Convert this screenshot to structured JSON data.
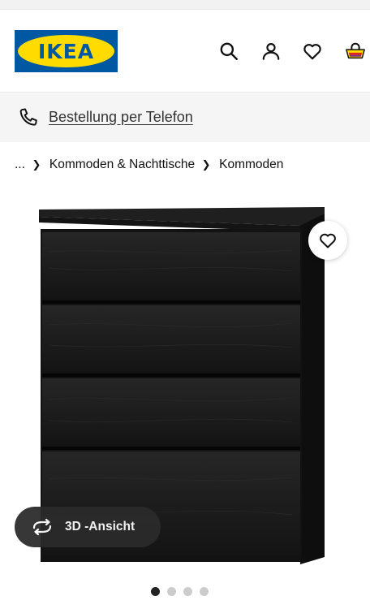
{
  "header": {
    "logo_text": "IKEA",
    "icons": [
      "search-icon",
      "user-icon",
      "heart-icon",
      "shopping-bag-icon"
    ]
  },
  "phone_bar": {
    "label": "Bestellung per Telefon",
    "icon": "phone-icon"
  },
  "breadcrumb": {
    "items": [
      "...",
      "Kommoden & Nachttische",
      "Kommoden"
    ]
  },
  "product": {
    "favourite_icon": "heart-icon",
    "view_3d_label": "3D -Ansicht",
    "image_count": 4,
    "active_image": 0
  },
  "colors": {
    "ikea_blue": "#0058a3",
    "ikea_yellow": "#ffdb00",
    "dresser": "#1a1a1a",
    "phone_bar_bg": "#f5f5f5"
  }
}
